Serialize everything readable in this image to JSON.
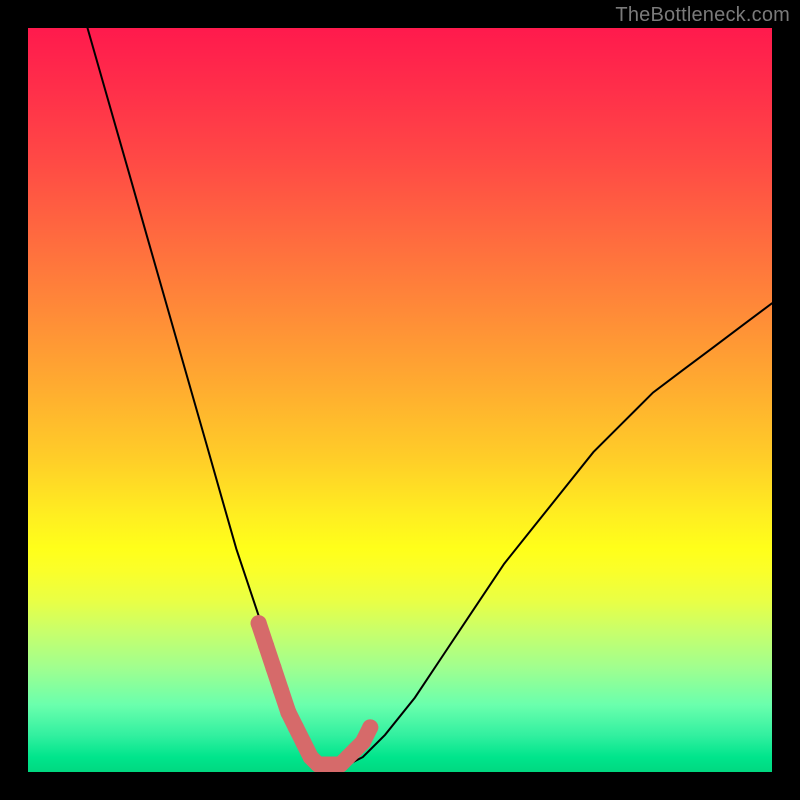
{
  "watermark": "TheBottleneck.com",
  "colors": {
    "frame": "#000000",
    "curve": "#000000",
    "marker": "#d66a6a",
    "gradient_top": "#ff1a4d",
    "gradient_bottom": "#00d880"
  },
  "chart_data": {
    "type": "line",
    "title": "",
    "xlabel": "",
    "ylabel": "",
    "xlim": [
      0,
      100
    ],
    "ylim": [
      0,
      100
    ],
    "grid": false,
    "legend": false,
    "note": "Axes are unitless percentages; x=0 at left, y=0 at bottom. Values estimated from pixel positions.",
    "series": [
      {
        "name": "bottleneck-curve",
        "x": [
          8,
          10,
          12,
          14,
          16,
          18,
          20,
          22,
          24,
          26,
          28,
          30,
          32,
          34,
          36,
          38,
          39,
          40,
          43,
          45,
          48,
          52,
          56,
          60,
          64,
          68,
          72,
          76,
          80,
          84,
          88,
          92,
          96,
          100
        ],
        "values": [
          100,
          93,
          86,
          79,
          72,
          65,
          58,
          51,
          44,
          37,
          30,
          24,
          18,
          13,
          8,
          4,
          2,
          1,
          1,
          2,
          5,
          10,
          16,
          22,
          28,
          33,
          38,
          43,
          47,
          51,
          54,
          57,
          60,
          63
        ]
      }
    ],
    "markers": {
      "name": "highlighted-range",
      "description": "thick pink segment near curve minimum",
      "x": [
        31,
        32,
        33,
        34,
        35,
        36,
        37,
        38,
        39,
        40,
        41,
        42,
        43,
        44,
        45,
        46
      ],
      "values": [
        20,
        17,
        14,
        11,
        8,
        6,
        4,
        2,
        1,
        1,
        1,
        1,
        2,
        3,
        4,
        6
      ]
    }
  }
}
